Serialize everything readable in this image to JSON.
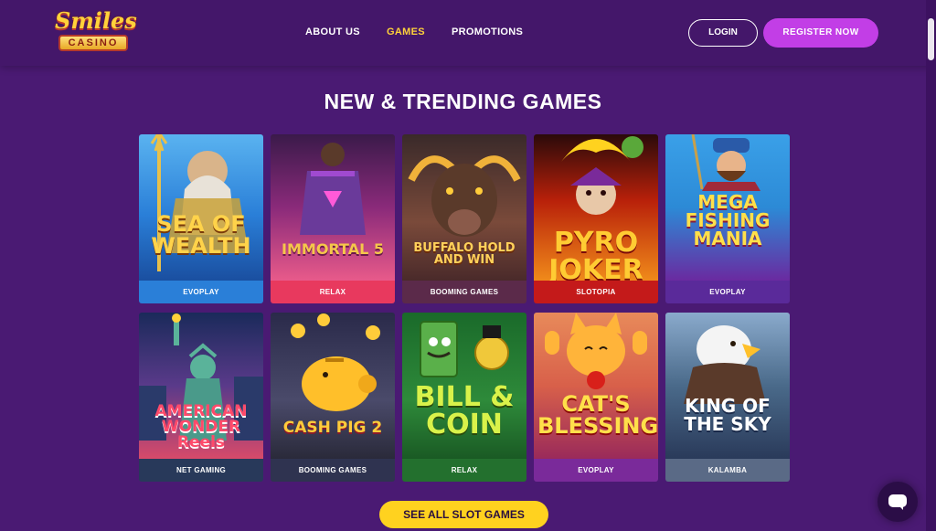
{
  "header": {
    "logo_top": "Smiles",
    "logo_bottom": "CASINO",
    "nav": [
      {
        "label": "ABOUT US",
        "active": false
      },
      {
        "label": "GAMES",
        "active": true
      },
      {
        "label": "PROMOTIONS",
        "active": false
      }
    ],
    "login_label": "LOGIN",
    "register_label": "REGISTER NOW"
  },
  "section": {
    "title": "NEW & TRENDING GAMES",
    "see_all_label": "SEE ALL SLOT GAMES"
  },
  "games": [
    {
      "title": "SEA OF WEALTH",
      "provider": "EVOPLAY",
      "bg": "#2a7fd8",
      "footer": "#2a7fd8",
      "title_color": "#ffd34a"
    },
    {
      "title": "IMMORTAL 5",
      "provider": "RELAX",
      "bg": "#a02a6a",
      "footer": "#e8395e",
      "title_color": "#f5c74a"
    },
    {
      "title": "BUFFALO HOLD AND WIN",
      "provider": "BOOMING GAMES",
      "bg": "#5a3a3a",
      "footer": "#5b2a4a",
      "title_color": "#ffd15a"
    },
    {
      "title": "PYRO JOKER",
      "provider": "SLOTOPIA",
      "bg": "#7a1410",
      "footer": "#c41a1a",
      "title_color": "#ffcc33"
    },
    {
      "title": "MEGA FISHING MANIA",
      "provider": "EVOPLAY",
      "bg": "#2c8ad6",
      "footer": "#5a2a9a",
      "title_color": "#ffe04a"
    },
    {
      "title": "AMERICAN WONDER Reels",
      "provider": "NET GAMING",
      "bg": "#2a3a6a",
      "footer": "#28395a",
      "title_color": "#ff4a6a"
    },
    {
      "title": "CASH PIG 2",
      "provider": "BOOMING GAMES",
      "bg": "#3a3a5a",
      "footer": "#2f3350",
      "title_color": "#ffcc3a"
    },
    {
      "title": "BILL & COIN",
      "provider": "RELAX",
      "bg": "#2e8a3a",
      "footer": "#23702e",
      "title_color": "#d9f24a"
    },
    {
      "title": "CAT'S BLESSING",
      "provider": "EVOPLAY",
      "bg": "#d8604a",
      "footer": "#7a2a9a",
      "title_color": "#ffe04a"
    },
    {
      "title": "KING OF THE SKY",
      "provider": "KALAMBA",
      "bg": "#4a6a8a",
      "footer": "#5a6a86",
      "title_color": "#ffffff"
    }
  ]
}
